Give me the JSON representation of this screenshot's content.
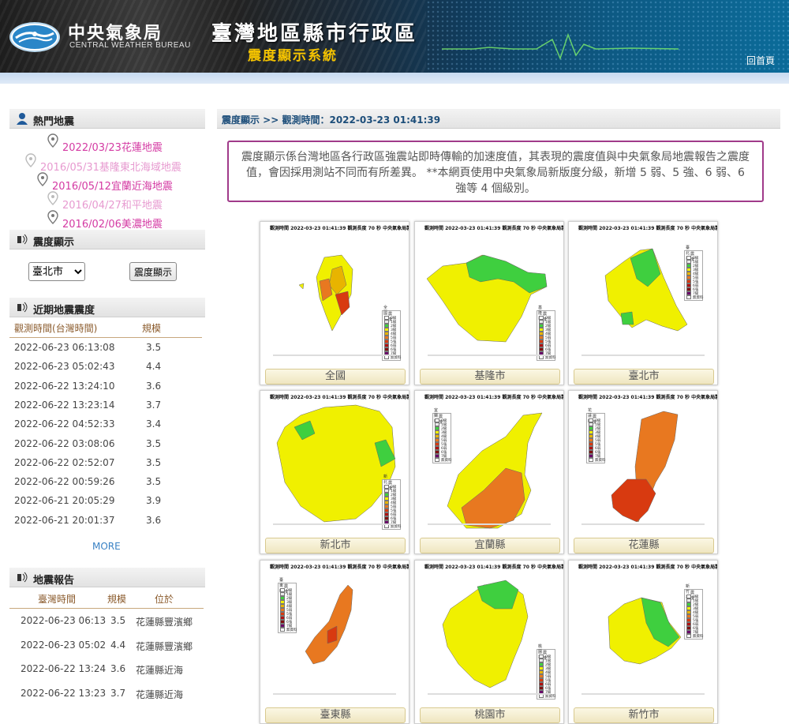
{
  "header": {
    "org_cn": "中央氣象局",
    "org_en": "CENTRAL WEATHER BUREAU",
    "title": "臺灣地區縣市行政區",
    "subtitle": "震度顯示系統",
    "home_link": "回首頁"
  },
  "sidebar": {
    "hot_title": "熱門地震",
    "hot_items": [
      {
        "label": "2022/03/23花蓮地震",
        "color": "#d43aa3"
      },
      {
        "label": "2016/05/31基隆東北海域地震",
        "color": "#e79ad0"
      },
      {
        "label": "2016/05/12宜蘭近海地震",
        "color": "#d43aa3"
      },
      {
        "label": "2016/04/27和平地震",
        "color": "#e79ad0"
      },
      {
        "label": "2016/02/06美濃地震",
        "color": "#d43aa3"
      }
    ],
    "intensity_title": "震度顯示",
    "city_select": "臺北市",
    "show_button": "震度顯示",
    "recent_title": "近期地震震度",
    "recent_headers": {
      "time": "觀測時間(台灣時間)",
      "mag": "規模"
    },
    "recent_rows": [
      {
        "time": "2022-06-23 06:13:08",
        "mag": "3.5"
      },
      {
        "time": "2022-06-23 05:02:43",
        "mag": "4.4"
      },
      {
        "time": "2022-06-22 13:24:10",
        "mag": "3.6"
      },
      {
        "time": "2022-06-22 13:23:14",
        "mag": "3.7"
      },
      {
        "time": "2022-06-22 04:52:33",
        "mag": "3.4"
      },
      {
        "time": "2022-06-22 03:08:06",
        "mag": "3.5"
      },
      {
        "time": "2022-06-22 02:52:07",
        "mag": "3.5"
      },
      {
        "time": "2022-06-22 00:59:26",
        "mag": "3.5"
      },
      {
        "time": "2022-06-21 20:05:29",
        "mag": "3.9"
      },
      {
        "time": "2022-06-21 20:01:37",
        "mag": "3.6"
      }
    ],
    "more": "MORE",
    "report_title": "地震報告",
    "report_headers": {
      "time": "臺灣時間",
      "mag": "規模",
      "loc": "位於"
    },
    "report_rows": [
      {
        "time": "2022-06-23 06:13",
        "mag": "3.5",
        "loc": "花蓮縣豐濱鄉"
      },
      {
        "time": "2022-06-23 05:02",
        "mag": "4.4",
        "loc": "花蓮縣豐濱鄉"
      },
      {
        "time": "2022-06-22 13:24",
        "mag": "3.6",
        "loc": "花蓮縣近海"
      },
      {
        "time": "2022-06-22 13:23",
        "mag": "3.7",
        "loc": "花蓮縣近海"
      }
    ]
  },
  "main": {
    "breadcrumb": "震度顯示 >> 觀測時間：2022-03-23 01:41:39",
    "notice": "震度顯示係台灣地區各行政區強震站即時傳輸的加速度值，其表現的震度值與中央氣象局地震報告之震度值，會因採用測站不同而有所差異。 **本網頁使用中央氣象局新版度分級，新增 5 弱、5 強、6 弱、6 強等 4 個級別。",
    "map_header": "觀測時間 2022-03-23 01:41:39  觀測長度  70 秒   中央氣象局製作",
    "legend_title": "震度",
    "legend_items": [
      {
        "label": "0級",
        "color": "#ffffff"
      },
      {
        "label": "1級",
        "color": "#e8e8e8"
      },
      {
        "label": "2級",
        "color": "#3fcf3f"
      },
      {
        "label": "3級",
        "color": "#f0f000"
      },
      {
        "label": "4級",
        "color": "#e8b400"
      },
      {
        "label": "5弱",
        "color": "#e87820"
      },
      {
        "label": "5強",
        "color": "#d83a10"
      },
      {
        "label": "6弱",
        "color": "#b01010"
      },
      {
        "label": "6強",
        "color": "#801010"
      },
      {
        "label": "7級",
        "color": "#6a0a6a"
      },
      {
        "label": "無資料",
        "color": "#ffffff"
      }
    ],
    "maps": [
      {
        "label": "全國",
        "small": "全國"
      },
      {
        "label": "基隆市",
        "small": "基隆市"
      },
      {
        "label": "臺北市",
        "small": "臺北市"
      },
      {
        "label": "新北市",
        "small": "新北市"
      },
      {
        "label": "宜蘭縣",
        "small": "宜蘭縣"
      },
      {
        "label": "花蓮縣",
        "small": "花蓮縣"
      },
      {
        "label": "臺東縣",
        "small": "臺東縣"
      },
      {
        "label": "桃園市",
        "small": "桃園市"
      },
      {
        "label": "新竹市",
        "small": "新竹市"
      }
    ]
  }
}
